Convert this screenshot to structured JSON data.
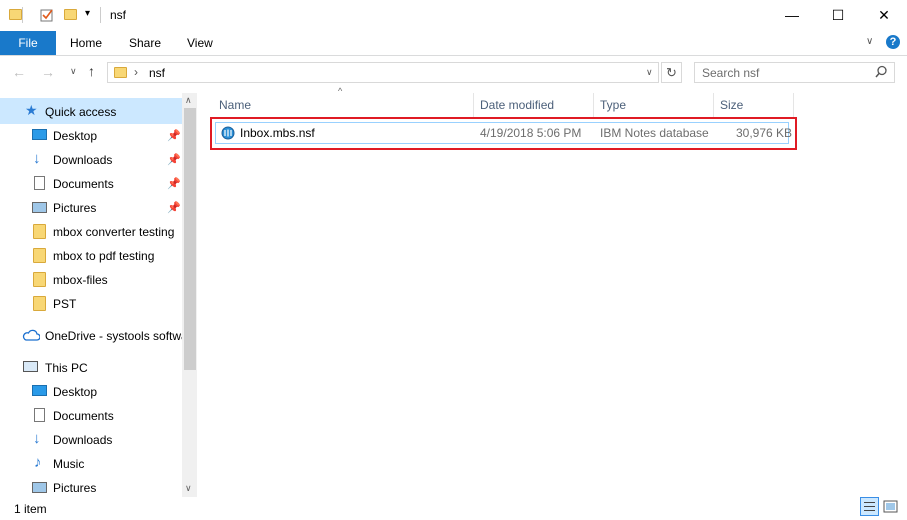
{
  "window": {
    "title": "nsf",
    "controls": {
      "minimize": "—",
      "maximize": "☐",
      "close": "✕"
    }
  },
  "ribbon": {
    "tabs": [
      {
        "label": "File"
      },
      {
        "label": "Home"
      },
      {
        "label": "Share"
      },
      {
        "label": "View"
      }
    ]
  },
  "address_bar": {
    "path": [
      "nsf"
    ],
    "search_placeholder": "Search nsf"
  },
  "nav_pane": {
    "items": [
      {
        "label": "Quick access",
        "icon": "star-icon"
      },
      {
        "label": "Desktop",
        "icon": "desktop-icon",
        "pinned": true
      },
      {
        "label": "Downloads",
        "icon": "download-arrow-icon",
        "pinned": true
      },
      {
        "label": "Documents",
        "icon": "documents-icon",
        "pinned": true
      },
      {
        "label": "Pictures",
        "icon": "pictures-icon",
        "pinned": true
      },
      {
        "label": "mbox converter testing",
        "icon": "folder-icon"
      },
      {
        "label": "mbox to pdf testing",
        "icon": "folder-icon"
      },
      {
        "label": "mbox-files",
        "icon": "folder-icon"
      },
      {
        "label": "PST",
        "icon": "folder-icon"
      },
      {
        "label": "OneDrive - systools softwa",
        "icon": "cloud-icon"
      },
      {
        "label": "This PC",
        "icon": "computer-icon"
      },
      {
        "label": "Desktop",
        "icon": "desktop-icon"
      },
      {
        "label": "Documents",
        "icon": "documents-icon"
      },
      {
        "label": "Downloads",
        "icon": "download-arrow-icon"
      },
      {
        "label": "Music",
        "icon": "music-note-icon"
      },
      {
        "label": "Pictures",
        "icon": "pictures-icon"
      }
    ]
  },
  "file_list": {
    "columns": [
      "Name",
      "Date modified",
      "Type",
      "Size"
    ],
    "rows": [
      {
        "name": "Inbox.mbs.nsf",
        "date_modified": "4/19/2018 5:06 PM",
        "type": "IBM Notes database",
        "size": "30,976 KB"
      }
    ]
  },
  "status_bar": {
    "item_count": "1 item"
  },
  "colors": {
    "accent": "#1979ca",
    "highlight_border": "#e01b24",
    "selection_border": "#99d1ff"
  }
}
